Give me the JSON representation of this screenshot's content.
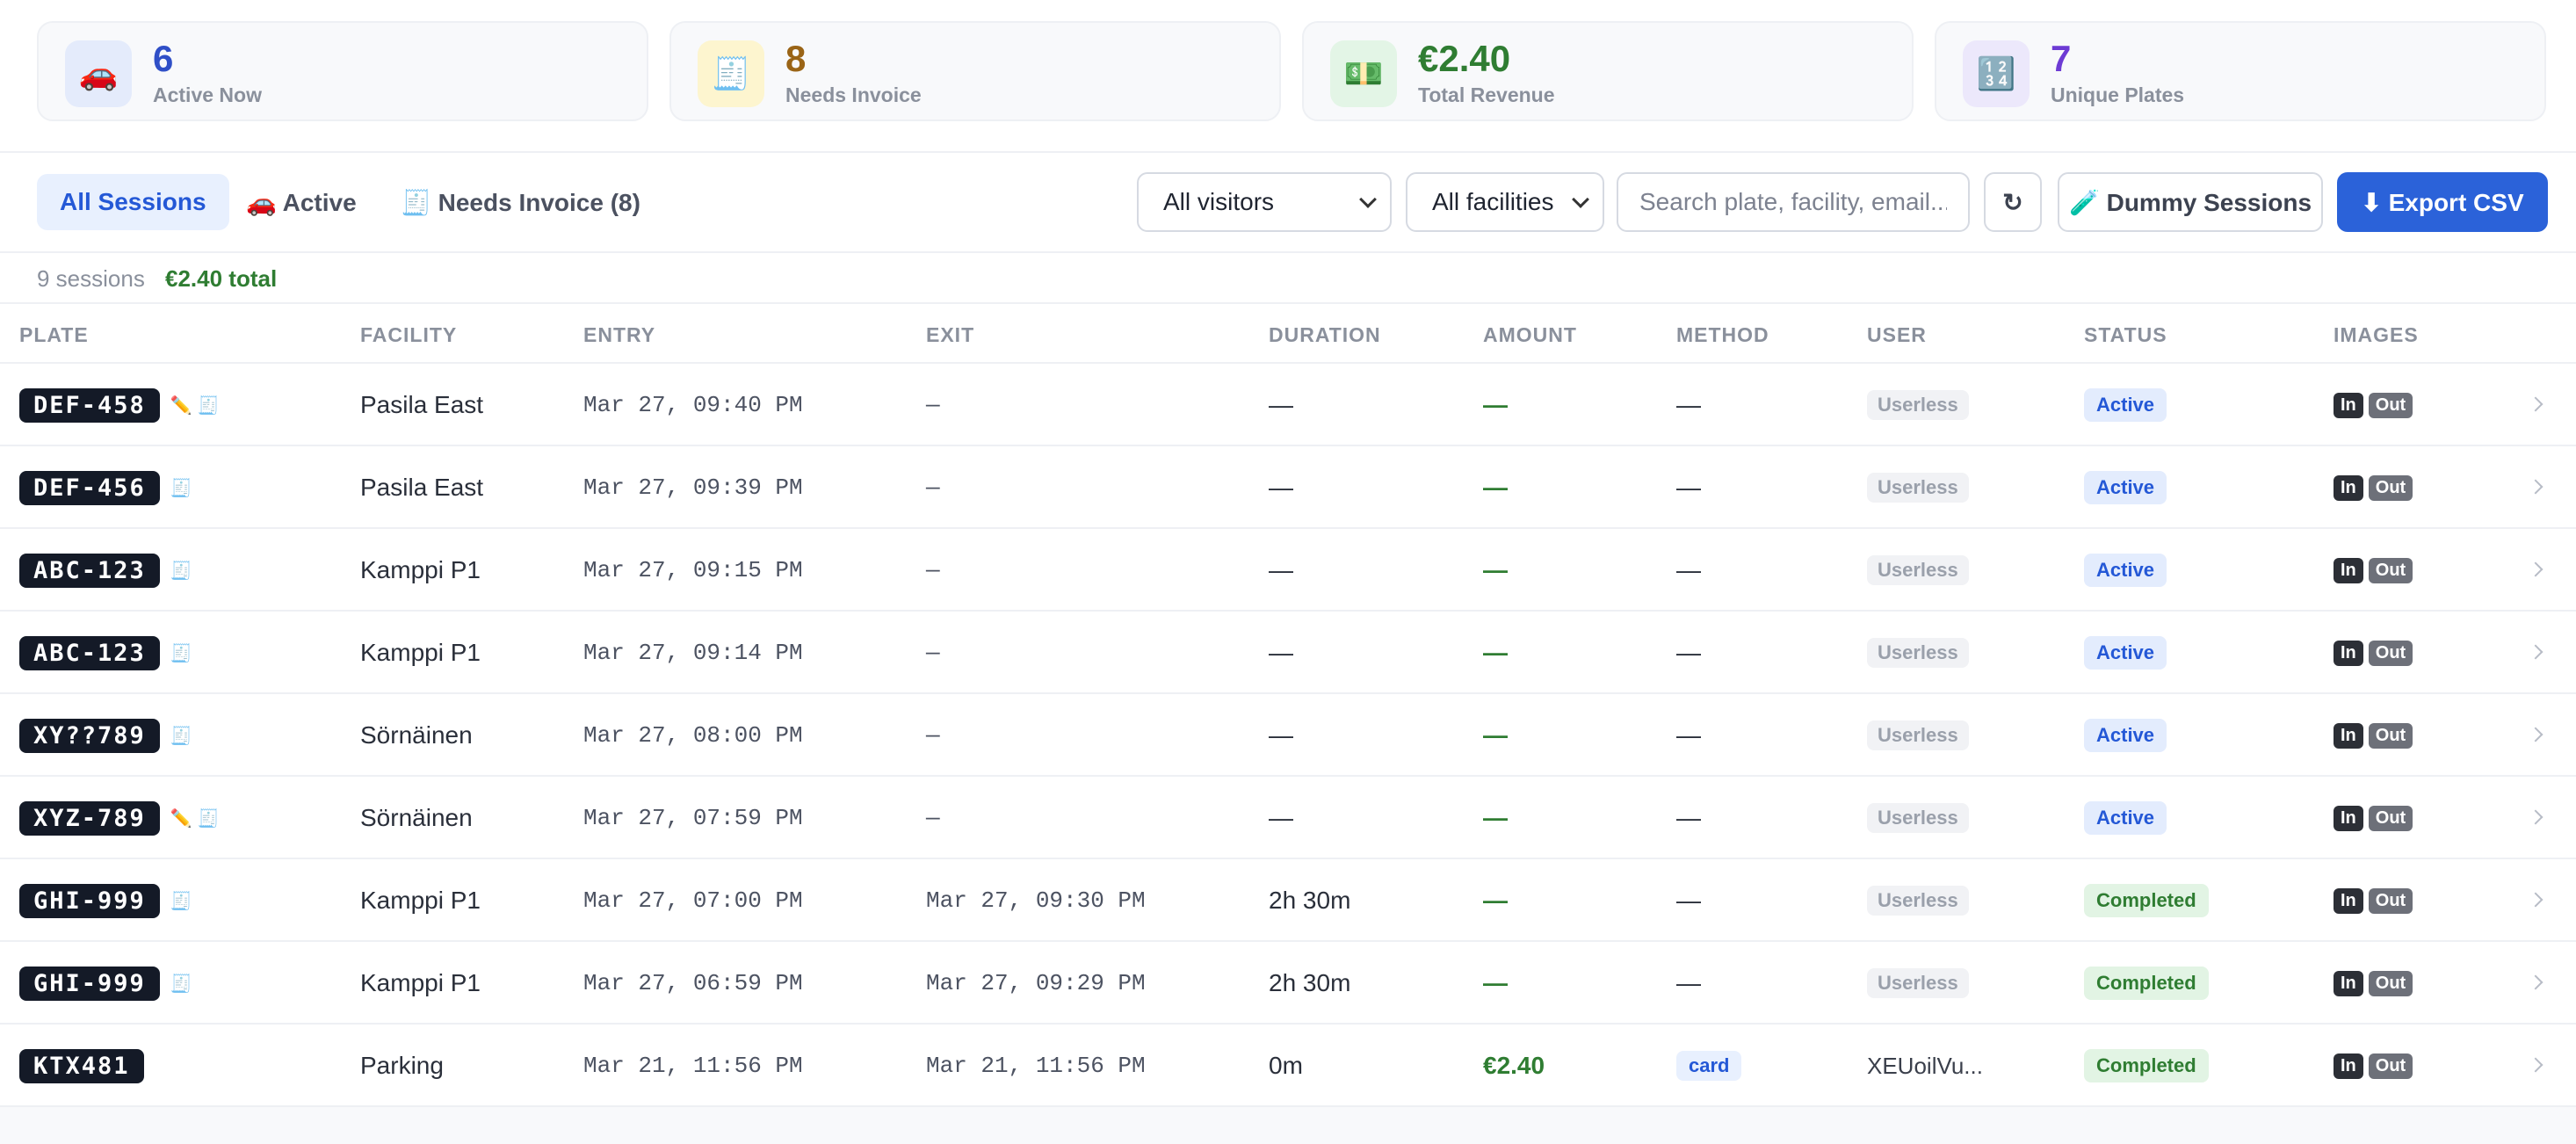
{
  "stats": [
    {
      "value": "6",
      "label": "Active Now",
      "icon": "car-icon",
      "glyph": "🚗",
      "color": "#2f4fc7",
      "bg": "#e4ebfb"
    },
    {
      "value": "8",
      "label": "Needs Invoice",
      "icon": "receipt-icon",
      "glyph": "🧾",
      "color": "#9a6416",
      "bg": "#fdf5cf"
    },
    {
      "value": "€2.40",
      "label": "Total Revenue",
      "icon": "money-icon",
      "glyph": "💵",
      "color": "#2f7d32",
      "bg": "#e3f5e6"
    },
    {
      "value": "7",
      "label": "Unique Plates",
      "icon": "numbers-icon",
      "glyph": "🔢",
      "color": "#6d3bd4",
      "bg": "#ece8fb"
    }
  ],
  "tabs": {
    "all": "All Sessions",
    "active": "🚗 Active",
    "needs_invoice": "🧾 Needs Invoice (8)"
  },
  "filters": {
    "visitors": "All visitors",
    "facilities": "All facilities",
    "search_placeholder": "Search plate, facility, email...",
    "refresh": "↻",
    "dummy": "🧪 Dummy Sessions",
    "export": "⬇ Export CSV"
  },
  "summary": {
    "count": "9 sessions",
    "total": "€2.40 total"
  },
  "columns": [
    "PLATE",
    "FACILITY",
    "ENTRY",
    "EXIT",
    "DURATION",
    "AMOUNT",
    "METHOD",
    "USER",
    "STATUS",
    "IMAGES"
  ],
  "image_labels": {
    "in": "In",
    "out": "Out"
  },
  "rows": [
    {
      "plate": "DEF-458",
      "edited": true,
      "facility": "Pasila East",
      "entry": "Mar 27, 09:40 PM",
      "exit": "—",
      "duration": "—",
      "amount": "—",
      "method": "—",
      "user": "Userless",
      "user_chip": true,
      "status": "Active"
    },
    {
      "plate": "DEF-456",
      "edited": false,
      "facility": "Pasila East",
      "entry": "Mar 27, 09:39 PM",
      "exit": "—",
      "duration": "—",
      "amount": "—",
      "method": "—",
      "user": "Userless",
      "user_chip": true,
      "status": "Active"
    },
    {
      "plate": "ABC-123",
      "edited": false,
      "facility": "Kamppi P1",
      "entry": "Mar 27, 09:15 PM",
      "exit": "—",
      "duration": "—",
      "amount": "—",
      "method": "—",
      "user": "Userless",
      "user_chip": true,
      "status": "Active"
    },
    {
      "plate": "ABC-123",
      "edited": false,
      "facility": "Kamppi P1",
      "entry": "Mar 27, 09:14 PM",
      "exit": "—",
      "duration": "—",
      "amount": "—",
      "method": "—",
      "user": "Userless",
      "user_chip": true,
      "status": "Active"
    },
    {
      "plate": "XY??789",
      "edited": false,
      "facility": "Sörnäinen",
      "entry": "Mar 27, 08:00 PM",
      "exit": "—",
      "duration": "—",
      "amount": "—",
      "method": "—",
      "user": "Userless",
      "user_chip": true,
      "status": "Active"
    },
    {
      "plate": "XYZ-789",
      "edited": true,
      "facility": "Sörnäinen",
      "entry": "Mar 27, 07:59 PM",
      "exit": "—",
      "duration": "—",
      "amount": "—",
      "method": "—",
      "user": "Userless",
      "user_chip": true,
      "status": "Active"
    },
    {
      "plate": "GHI-999",
      "edited": false,
      "facility": "Kamppi P1",
      "entry": "Mar 27, 07:00 PM",
      "exit": "Mar 27, 09:30 PM",
      "duration": "2h 30m",
      "amount": "—",
      "method": "—",
      "user": "Userless",
      "user_chip": true,
      "status": "Completed"
    },
    {
      "plate": "GHI-999",
      "edited": false,
      "facility": "Kamppi P1",
      "entry": "Mar 27, 06:59 PM",
      "exit": "Mar 27, 09:29 PM",
      "duration": "2h 30m",
      "amount": "—",
      "method": "—",
      "user": "Userless",
      "user_chip": true,
      "status": "Completed"
    },
    {
      "plate": "KTX481",
      "edited": false,
      "no_invoice_icon": true,
      "facility": "Parking",
      "entry": "Mar 21, 11:56 PM",
      "exit": "Mar 21, 11:56 PM",
      "duration": "0m",
      "amount": "€2.40",
      "method": "card",
      "user": "XEUoilVu...",
      "user_chip": false,
      "status": "Completed"
    }
  ]
}
